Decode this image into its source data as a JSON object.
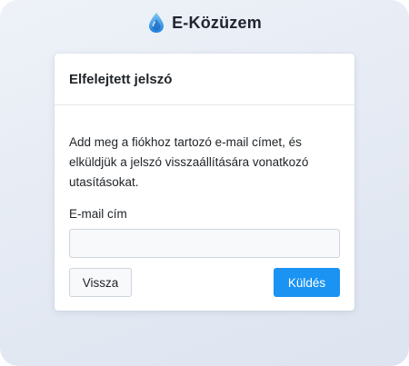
{
  "app": {
    "brand_name": "E-Közüzem",
    "brand_icon": "water-drop-icon",
    "accent_color": "#1a93f2"
  },
  "card": {
    "title": "Elfelejtett jelszó",
    "description": "Add meg a fiókhoz tartozó e-mail címet, és elküldjük a jelszó visszaállítására vonatkozó utasításokat.",
    "email_label": "E-mail cím",
    "email_value": "",
    "email_placeholder": ""
  },
  "actions": {
    "back_label": "Vissza",
    "send_label": "Küldés"
  }
}
